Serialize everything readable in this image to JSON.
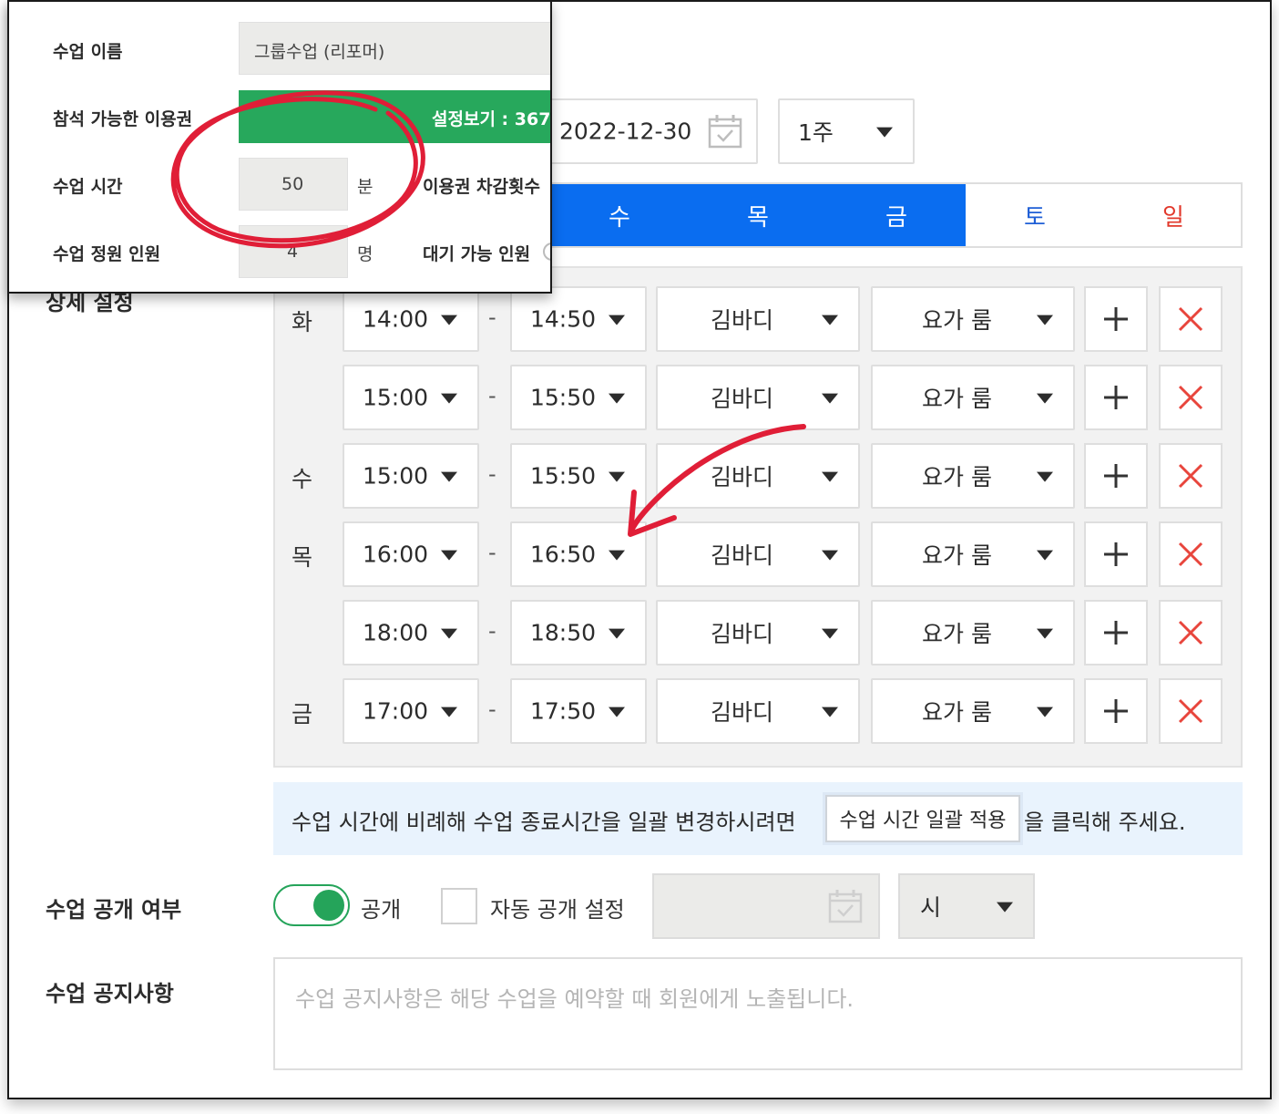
{
  "header": {
    "date_value": "2022-12-30",
    "week_select": "1주"
  },
  "day_tabs": [
    {
      "label": "수",
      "active": true
    },
    {
      "label": "목",
      "active": true
    },
    {
      "label": "금",
      "active": true
    },
    {
      "label": "토",
      "active": false,
      "color": "#1f5fd6"
    },
    {
      "label": "일",
      "active": false,
      "color": "#e2382b"
    }
  ],
  "detail_setting_label": "상세 설정",
  "schedule": {
    "rows": [
      {
        "day": "화",
        "start": "14:00",
        "end": "14:50",
        "instructor": "김바디",
        "room": "요가 룸"
      },
      {
        "day": "",
        "start": "15:00",
        "end": "15:50",
        "instructor": "김바디",
        "room": "요가 룸"
      },
      {
        "day": "수",
        "start": "15:00",
        "end": "15:50",
        "instructor": "김바디",
        "room": "요가 룸"
      },
      {
        "day": "목",
        "start": "16:00",
        "end": "16:50",
        "instructor": "김바디",
        "room": "요가 룸"
      },
      {
        "day": "",
        "start": "18:00",
        "end": "18:50",
        "instructor": "김바디",
        "room": "요가 룸"
      },
      {
        "day": "금",
        "start": "17:00",
        "end": "17:50",
        "instructor": "김바디",
        "room": "요가 룸"
      }
    ],
    "dash": "-"
  },
  "banner": {
    "text_before": "수업 시간에 비례해 수업 종료시간을 일괄 변경하시려면",
    "button_label": "수업 시간 일괄 적용",
    "text_after": "을 클릭해 주세요."
  },
  "open_setting": {
    "label": "수업 공개 여부",
    "toggle_label": "공개",
    "toggle_on": true,
    "auto_open_label": "자동 공개 설정",
    "hour_select": "시"
  },
  "notice": {
    "label": "수업 공지사항",
    "placeholder": "수업 공지사항은 해당 수업을 예약할 때 회원에게 노출됩니다."
  },
  "inset": {
    "class_name_label": "수업 이름",
    "class_name_value": "그룹수업 (리포머)",
    "ticket_label": "참석 가능한 이용권",
    "ticket_button": "설정보기 : 367",
    "duration_label": "수업 시간",
    "duration_value": "50",
    "duration_unit": "분",
    "deduct_label": "이용권 차감횟수",
    "capacity_label": "수업 정원 인원",
    "capacity_value": "4",
    "capacity_unit": "명",
    "waitlist_label": "대기 가능 인원"
  },
  "colors": {
    "primary_blue": "#0a6df0",
    "green": "#25a45a",
    "delete_red": "#e8453c",
    "annotation_red": "#e01e37"
  }
}
